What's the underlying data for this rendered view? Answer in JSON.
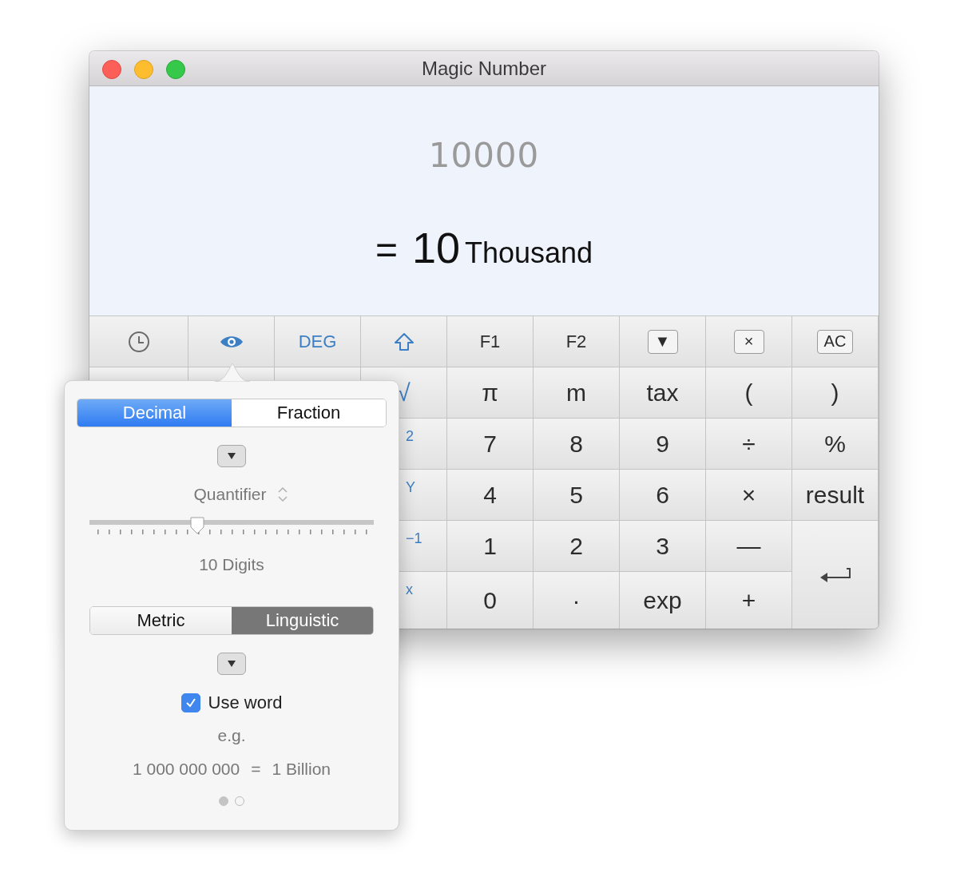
{
  "window": {
    "title": "Magic Number"
  },
  "display": {
    "input": "10000",
    "equals": "=",
    "value": "10",
    "unit": "Thousand"
  },
  "keys": [
    {
      "kind": "history",
      "color": "#6b6b6b"
    },
    {
      "kind": "view",
      "color": "#3d7fc4"
    },
    {
      "kind": "text",
      "label": "DEG",
      "color": "#3d7fc4"
    },
    {
      "kind": "shift",
      "color": "#3d7fc4"
    },
    {
      "kind": "text",
      "label": "F1",
      "color": "#2c2c2c"
    },
    {
      "kind": "text",
      "label": "F2",
      "color": "#2c2c2c"
    },
    {
      "kind": "cap",
      "label": "▼",
      "color": "#2c2c2c"
    },
    {
      "kind": "cap",
      "label": "×",
      "color": "#2c2c2c"
    },
    {
      "kind": "cap",
      "label": "AC",
      "color": "#2c2c2c"
    },
    {
      "kind": "peek"
    },
    {
      "kind": "peek"
    },
    {
      "kind": "peek"
    },
    {
      "kind": "text",
      "label": "√",
      "color": "#3d7fc4"
    },
    {
      "kind": "text",
      "label": "π",
      "color": "#2c2c2c"
    },
    {
      "kind": "text",
      "label": "m",
      "color": "#2c2c2c"
    },
    {
      "kind": "text",
      "label": "tax",
      "color": "#2c2c2c"
    },
    {
      "kind": "text",
      "label": "(",
      "color": "#2c2c2c"
    },
    {
      "kind": "text",
      "label": ")",
      "color": "#2c2c2c"
    },
    {
      "kind": "hidden"
    },
    {
      "kind": "hidden"
    },
    {
      "kind": "hidden"
    },
    {
      "kind": "partial",
      "label": "$^{2}$",
      "color": "#3d7fc4"
    },
    {
      "kind": "text",
      "label": "7",
      "color": "#2c2c2c"
    },
    {
      "kind": "text",
      "label": "8",
      "color": "#2c2c2c"
    },
    {
      "kind": "text",
      "label": "9",
      "color": "#2c2c2c"
    },
    {
      "kind": "text",
      "label": "÷",
      "color": "#2c2c2c"
    },
    {
      "kind": "text",
      "label": "%",
      "color": "#2c2c2c"
    },
    {
      "kind": "hidden"
    },
    {
      "kind": "hidden"
    },
    {
      "kind": "hidden"
    },
    {
      "kind": "partial",
      "label": "$^{Y}$",
      "color": "#3d7fc4"
    },
    {
      "kind": "text",
      "label": "4",
      "color": "#2c2c2c"
    },
    {
      "kind": "text",
      "label": "5",
      "color": "#2c2c2c"
    },
    {
      "kind": "text",
      "label": "6",
      "color": "#2c2c2c"
    },
    {
      "kind": "text",
      "label": "×",
      "color": "#2c2c2c"
    },
    {
      "kind": "text",
      "label": "result",
      "color": "#2c2c2c"
    },
    {
      "kind": "hidden"
    },
    {
      "kind": "hidden"
    },
    {
      "kind": "hidden"
    },
    {
      "kind": "partial",
      "label": "$^{−1}$",
      "color": "#3d7fc4"
    },
    {
      "kind": "text",
      "label": "1",
      "color": "#2c2c2c"
    },
    {
      "kind": "text",
      "label": "2",
      "color": "#2c2c2c"
    },
    {
      "kind": "text",
      "label": "3",
      "color": "#2c2c2c"
    },
    {
      "kind": "text",
      "label": "—",
      "color": "#2c2c2c"
    },
    {
      "kind": "enter",
      "color": "#444444"
    },
    {
      "kind": "hidden"
    },
    {
      "kind": "hidden"
    },
    {
      "kind": "hidden"
    },
    {
      "kind": "partial",
      "label": "$^{x}$",
      "color": "#3d7fc4"
    },
    {
      "kind": "text",
      "label": "0",
      "color": "#2c2c2c"
    },
    {
      "kind": "text",
      "label": "·",
      "color": "#2c2c2c"
    },
    {
      "kind": "text",
      "label": "exp",
      "color": "#2c2c2c"
    },
    {
      "kind": "text",
      "label": "+",
      "color": "#2c2c2c"
    }
  ],
  "popover": {
    "format_tabs": [
      {
        "label": "Decimal",
        "selected": true
      },
      {
        "label": "Fraction",
        "selected": false
      }
    ],
    "quantifier": {
      "label": "Quantifier"
    },
    "digits_slider": {
      "level": 0.38
    },
    "digits_label": "10 Digits",
    "style_tabs": [
      {
        "label": "Metric",
        "selected": false
      },
      {
        "label": "Linguistic",
        "selected": true
      }
    ],
    "use_word": {
      "label": "Use word",
      "checked": true
    },
    "example_label": "e.g.",
    "example_number": "1 000 000 000",
    "example_equals": "=",
    "example_word": "1 Billion",
    "pages": [
      {
        "selected": true
      },
      {
        "selected": false
      }
    ]
  }
}
